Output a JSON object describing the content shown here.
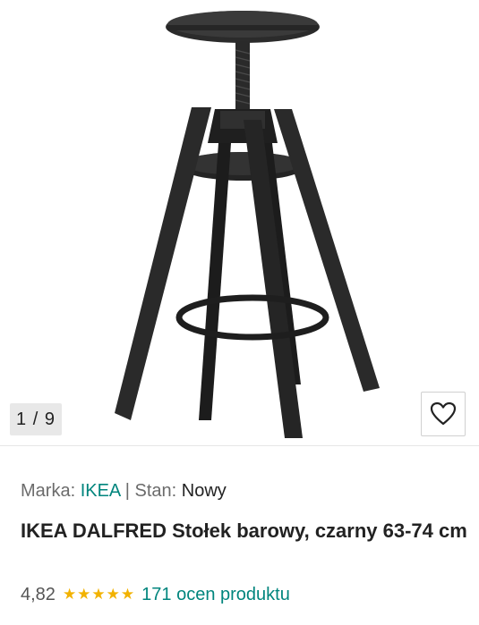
{
  "gallery": {
    "counter": "1 / 9",
    "favorite_icon": "heart-outline-icon",
    "image_icon": "bar-stool-product-photo"
  },
  "product": {
    "brand_label": "Marka:",
    "brand_value": "IKEA",
    "separator": "|",
    "condition_label": "Stan:",
    "condition_value": "Nowy",
    "title": "IKEA DALFRED Stołek barowy, czarny 63-74 cm",
    "rating_value": "4,82",
    "stars": "★★★★★",
    "reviews_link": "171 ocen produktu"
  },
  "colors": {
    "accent": "#00857d",
    "stars": "#f2b200"
  }
}
